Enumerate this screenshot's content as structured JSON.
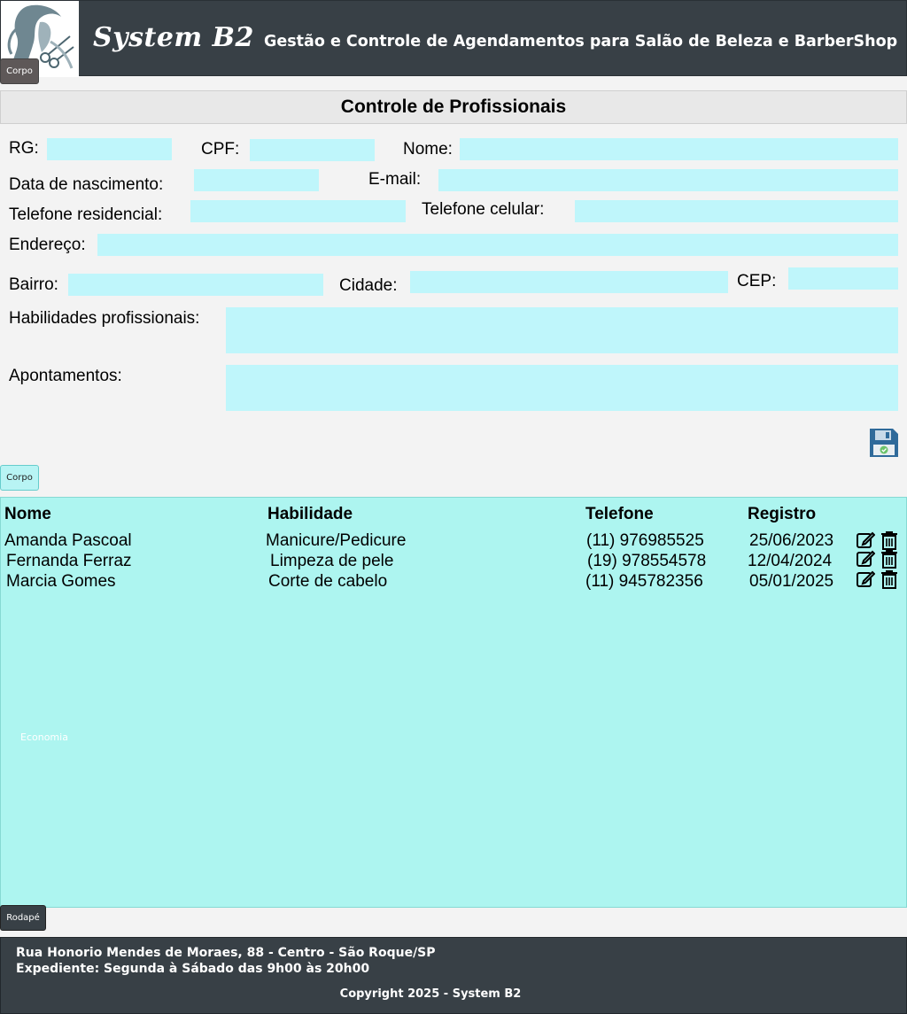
{
  "header": {
    "brand": "System B2",
    "tagline": "Gestão e Controle de Agendamentos para Salão de Beleza e BarberShop",
    "logo_icon": "salon-woman-hair-logo-icon",
    "section_tag": "Corpo"
  },
  "page": {
    "title": "Controle de Profissionais"
  },
  "form": {
    "rg_label": "RG:",
    "rg_value": "",
    "cpf_label": "CPF:",
    "cpf_value": "",
    "nome_label": "Nome:",
    "nome_value": "",
    "nascimento_label": "Data de nascimento:",
    "nascimento_value": "",
    "email_label": "E-mail:",
    "email_value": "",
    "tel_res_label": "Telefone residencial:",
    "tel_res_value": "",
    "tel_cel_label": "Telefone celular:",
    "tel_cel_value": "",
    "endereco_label": "Endereço:",
    "endereco_value": "",
    "bairro_label": "Bairro:",
    "bairro_value": "",
    "cidade_label": "Cidade:",
    "cidade_value": "",
    "cep_label": "CEP:",
    "cep_value": "",
    "habilidades_label": "Habilidades profissionais:",
    "habilidades_value": "",
    "apontamentos_label": "Apontamentos:",
    "apontamentos_value": "",
    "save_icon": "floppy-disk-save-icon",
    "section_tag": "Corpo"
  },
  "table": {
    "columns": [
      "Nome",
      "Habilidade",
      "Telefone",
      "Registro"
    ],
    "rows": [
      {
        "nome": "Amanda Pascoal",
        "habilidade": "Manicure/Pedicure",
        "telefone": "(11) 976985525",
        "registro": "25/06/2023"
      },
      {
        "nome": "Fernanda Ferraz",
        "habilidade": "Limpeza de pele",
        "telefone": "(19) 978554578",
        "registro": "12/04/2024"
      },
      {
        "nome": "Marcia Gomes",
        "habilidade": "Corte de cabelo",
        "telefone": "(11) 945782356",
        "registro": "05/01/2025"
      }
    ],
    "edit_icon": "edit-pencil-icon",
    "delete_icon": "trash-icon",
    "watermark": "Economia"
  },
  "footer": {
    "section_tag": "Rodapé",
    "address": "Rua Honorio Mendes de Moraes, 88  - Centro - São Roque/SP",
    "hours": "Expediente:  Segunda à Sábado das 9h00 às 20h00",
    "copyright": "Copyright 2025 - System B2"
  },
  "colors": {
    "header_bg": "#384046",
    "field_bg": "#bff6fb",
    "table_bg": "#adf5f0",
    "save_icon": "#2f6a9a"
  }
}
